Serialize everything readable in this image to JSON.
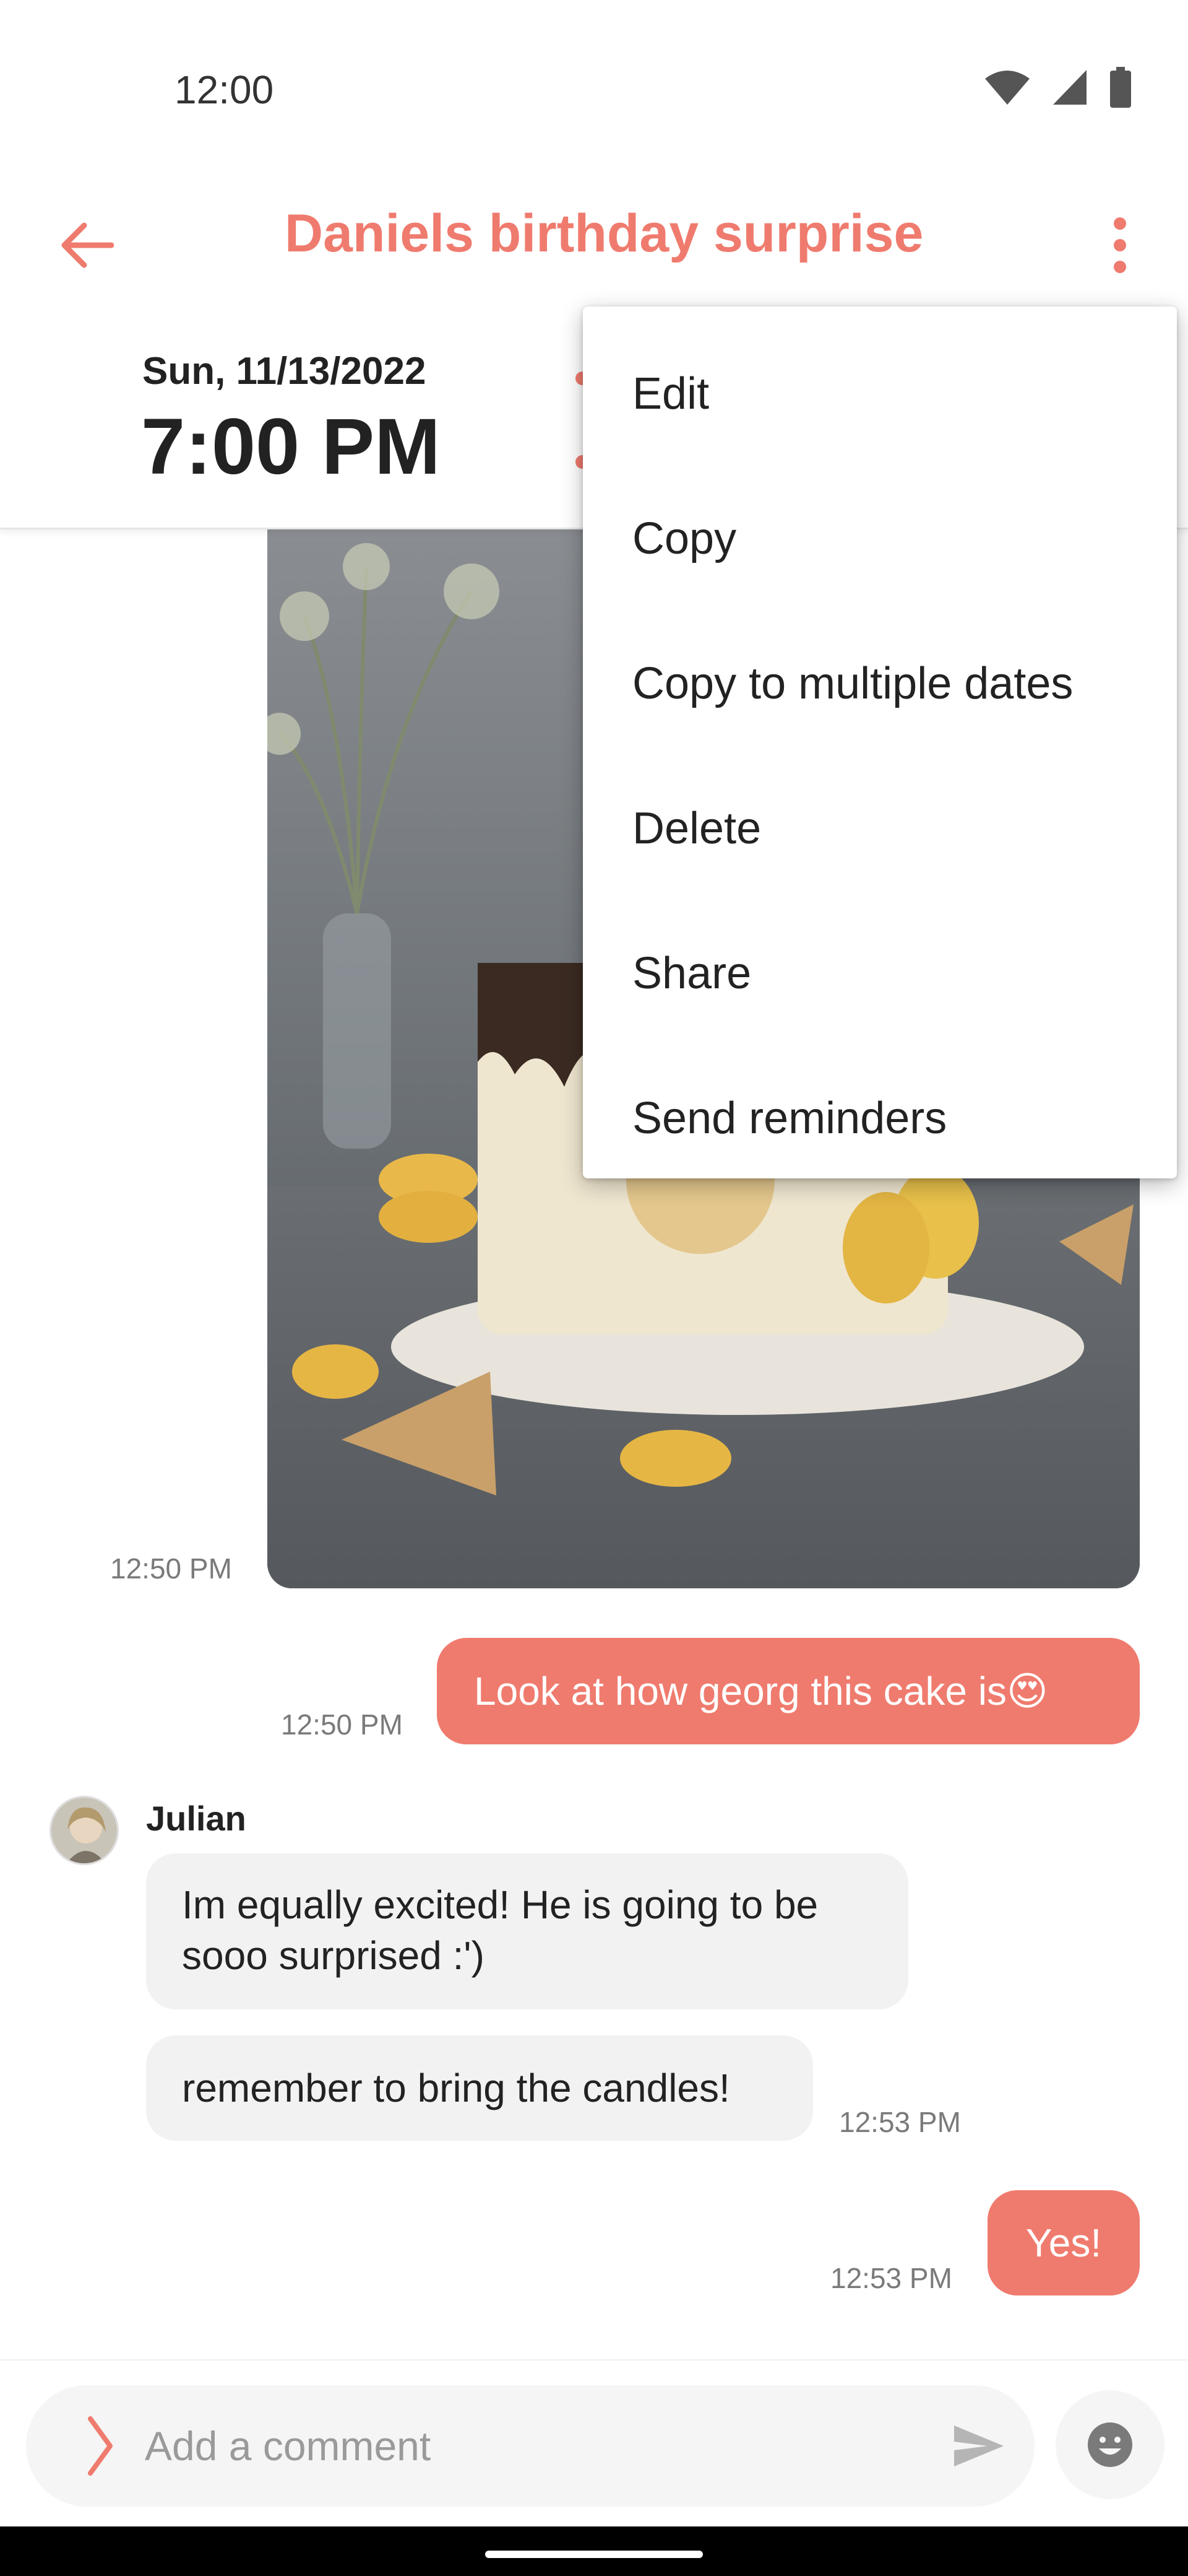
{
  "status_bar": {
    "time": "12:00",
    "icons": [
      "wifi-icon",
      "cellular-signal-icon",
      "battery-icon"
    ]
  },
  "app_bar": {
    "title": "Daniels birthday surprise",
    "back_icon": "arrow-left-icon",
    "more_icon": "more-vert-icon"
  },
  "event": {
    "date": "Sun, 11/13/2022",
    "time": "7:00 PM"
  },
  "menu": {
    "items": [
      {
        "label": "Edit"
      },
      {
        "label": "Copy"
      },
      {
        "label": "Copy to multiple dates"
      },
      {
        "label": "Delete"
      },
      {
        "label": "Share"
      },
      {
        "label": "Send reminders"
      }
    ]
  },
  "chat": {
    "photo_message": {
      "timestamp": "12:50 PM"
    },
    "outgoing_1": {
      "text": "Look at how georg this cake is😍",
      "timestamp": "12:50 PM"
    },
    "incoming_group": {
      "sender": "Julian",
      "messages": [
        {
          "text": "Im equally excited! He is going to be sooo surprised :')"
        },
        {
          "text": "remember to bring the candles!",
          "timestamp": "12:53 PM"
        }
      ]
    },
    "outgoing_2": {
      "text": "Yes!",
      "timestamp": "12:53 PM"
    }
  },
  "composer": {
    "placeholder": "Add a comment",
    "icons": [
      "chevron-right-icon",
      "send-icon",
      "emoji-icon"
    ]
  },
  "colors": {
    "accent": "#ef7b6e",
    "bubble_incoming": "#f2f2f2"
  }
}
